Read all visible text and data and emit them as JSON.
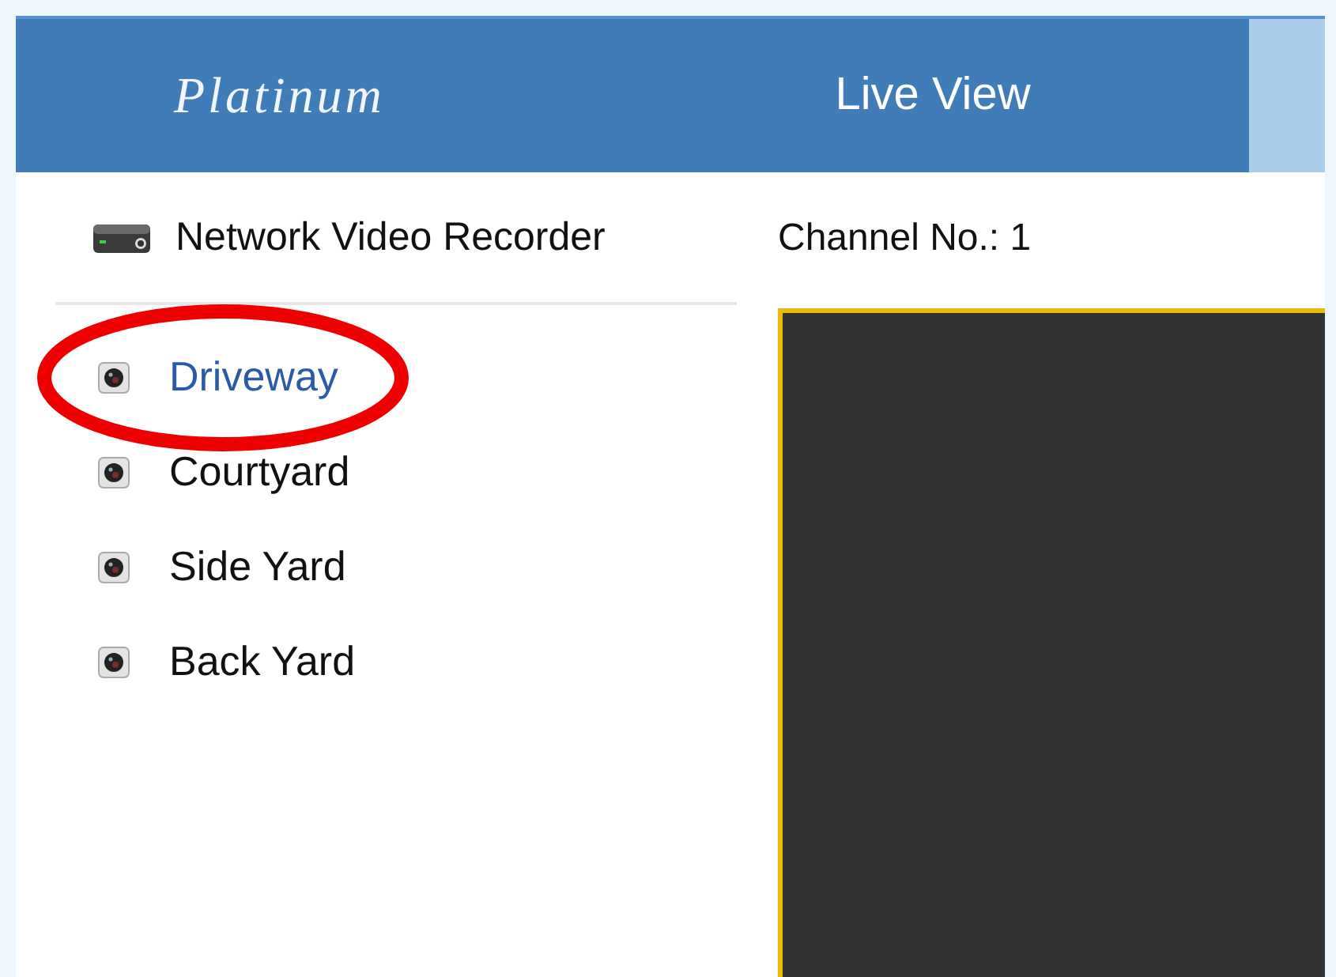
{
  "header": {
    "logo": "Platinum",
    "tabs": [
      {
        "label": "Live View",
        "selected": false
      }
    ]
  },
  "sidebar": {
    "device": "Network Video Recorder",
    "cameras": [
      {
        "name": "Driveway",
        "selected": true,
        "annotated": true
      },
      {
        "name": "Courtyard",
        "selected": false,
        "annotated": false
      },
      {
        "name": "Side Yard",
        "selected": false,
        "annotated": false
      },
      {
        "name": "Back Yard",
        "selected": false,
        "annotated": false
      }
    ]
  },
  "main": {
    "channel_label": "Channel No.: 1"
  }
}
